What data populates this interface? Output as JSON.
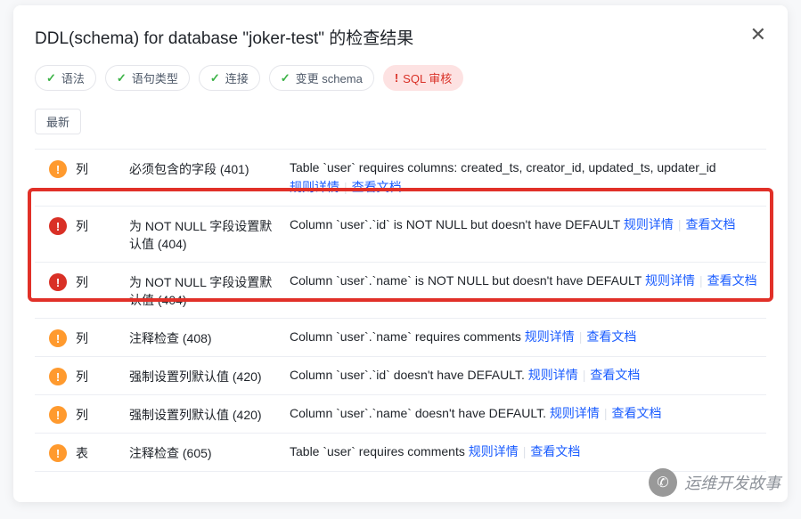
{
  "modal": {
    "title": "DDL(schema) for database \"joker-test\" 的检查结果"
  },
  "tags": {
    "syntax": "语法",
    "stmt_type": "语句类型",
    "connection": "连接",
    "schema_change": "变更 schema",
    "sql_audit": "SQL 审核"
  },
  "latest_label": "最新",
  "rows": [
    {
      "severity": "warn",
      "category": "列",
      "rule": "必须包含的字段 (401)",
      "message": "Table `user` requires columns: created_ts, creator_id, updated_ts, updater_id",
      "link_detail": "规则详情",
      "link_doc": "查看文档"
    },
    {
      "severity": "error",
      "category": "列",
      "rule": "为 NOT NULL 字段设置默认值 (404)",
      "message": "Column `user`.`id` is NOT NULL but doesn't have DEFAULT",
      "link_detail": "规则详情",
      "link_doc": "查看文档"
    },
    {
      "severity": "error",
      "category": "列",
      "rule": "为 NOT NULL 字段设置默认值 (404)",
      "message": "Column `user`.`name` is NOT NULL but doesn't have DEFAULT",
      "link_detail": "规则详情",
      "link_doc": "查看文档"
    },
    {
      "severity": "warn",
      "category": "列",
      "rule": "注释检查 (408)",
      "message": "Column `user`.`name` requires comments",
      "link_detail": "规则详情",
      "link_doc": "查看文档"
    },
    {
      "severity": "warn",
      "category": "列",
      "rule": "强制设置列默认值 (420)",
      "message": "Column `user`.`id` doesn't have DEFAULT.",
      "link_detail": "规则详情",
      "link_doc": "查看文档"
    },
    {
      "severity": "warn",
      "category": "列",
      "rule": "强制设置列默认值 (420)",
      "message": "Column `user`.`name` doesn't have DEFAULT.",
      "link_detail": "规则详情",
      "link_doc": "查看文档"
    },
    {
      "severity": "warn",
      "category": "表",
      "rule": "注释检查 (605)",
      "message": "Table `user` requires comments",
      "link_detail": "规则详情",
      "link_doc": "查看文档"
    }
  ],
  "watermark": {
    "text": "运维开发故事"
  }
}
